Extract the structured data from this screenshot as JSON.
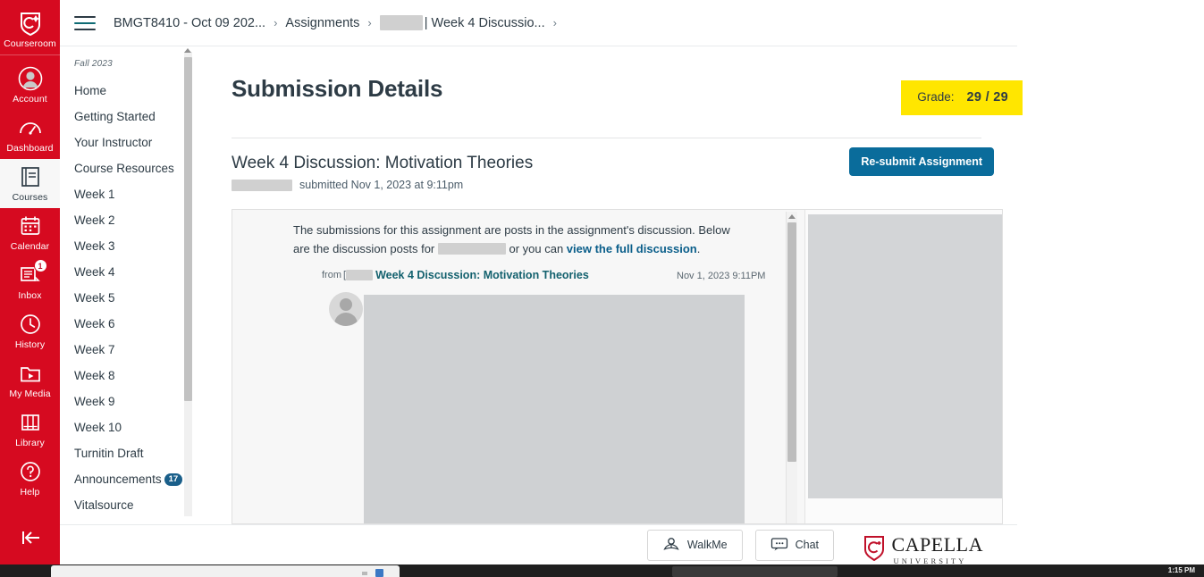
{
  "global_nav": {
    "items": [
      {
        "label": "Courseroom",
        "icon": "capella-shield-icon",
        "active": false
      },
      {
        "label": "Account",
        "icon": "user-avatar-icon",
        "active": false
      },
      {
        "label": "Dashboard",
        "icon": "dashboard-icon",
        "active": false
      },
      {
        "label": "Courses",
        "icon": "book-icon",
        "active": true
      },
      {
        "label": "Calendar",
        "icon": "calendar-icon",
        "active": false
      },
      {
        "label": "Inbox",
        "icon": "inbox-icon",
        "active": false,
        "badge": "1"
      },
      {
        "label": "History",
        "icon": "clock-icon",
        "active": false
      },
      {
        "label": "My Media",
        "icon": "media-folder-icon",
        "active": false
      },
      {
        "label": "Library",
        "icon": "library-books-icon",
        "active": false
      },
      {
        "label": "Help",
        "icon": "question-circle-icon",
        "active": false
      }
    ],
    "collapse_icon": "collapse-left-arrow-icon",
    "brand_color": "#d60a20"
  },
  "breadcrumb": {
    "menu_icon": "hamburger-menu-icon",
    "items": [
      {
        "label": "BMGT8410 - Oct 09 202...",
        "redacted": false
      },
      {
        "label": "Assignments",
        "redacted": false
      },
      {
        "label": "| Week 4 Discussio...",
        "redacted": true
      }
    ],
    "separator": "›",
    "trailing_separator": "›"
  },
  "course_nav": {
    "term": "Fall 2023",
    "items": [
      {
        "label": "Home"
      },
      {
        "label": "Getting Started"
      },
      {
        "label": "Your Instructor"
      },
      {
        "label": "Course Resources"
      },
      {
        "label": "Week 1"
      },
      {
        "label": "Week 2"
      },
      {
        "label": "Week 3"
      },
      {
        "label": "Week 4"
      },
      {
        "label": "Week 5"
      },
      {
        "label": "Week 6"
      },
      {
        "label": "Week 7"
      },
      {
        "label": "Week 8"
      },
      {
        "label": "Week 9"
      },
      {
        "label": "Week 10"
      },
      {
        "label": "Turnitin Draft"
      },
      {
        "label": "Announcements",
        "badge": "17"
      },
      {
        "label": "Vitalsource"
      }
    ]
  },
  "main": {
    "page_title": "Submission Details",
    "grade": {
      "label": "Grade:",
      "value": "29 / 29",
      "highlight_color": "#ffe600"
    },
    "assignment": {
      "title": "Week 4 Discussion: Motivation Theories",
      "submitted_text": "submitted Nov 1, 2023 at 9:11pm",
      "resubmit_button": "Re-submit Assignment",
      "button_color": "#0a6c9b"
    },
    "preview": {
      "intro_part1": "The submissions for this assignment are posts in the assignment's discussion. Below are the discussion posts for ",
      "intro_part2": " or you can ",
      "intro_link": "view the full discussion",
      "intro_end": ".",
      "from_label": "from",
      "bracket": "[",
      "topic_link": "Week 4 Discussion: Motivation Theories",
      "post_date": "Nov 1, 2023 9:11PM",
      "avatar_icon": "user-avatar-icon"
    }
  },
  "footer": {
    "walkme": {
      "label": "WalkMe",
      "icon": "walkme-rocket-icon"
    },
    "chat": {
      "label": "Chat",
      "icon": "chat-bubble-icon"
    },
    "logo": {
      "name": "CAPELLA",
      "subtitle": "UNIVERSITY",
      "icon": "capella-shield-icon"
    }
  },
  "taskbar": {
    "clock": "1:15 PM"
  }
}
